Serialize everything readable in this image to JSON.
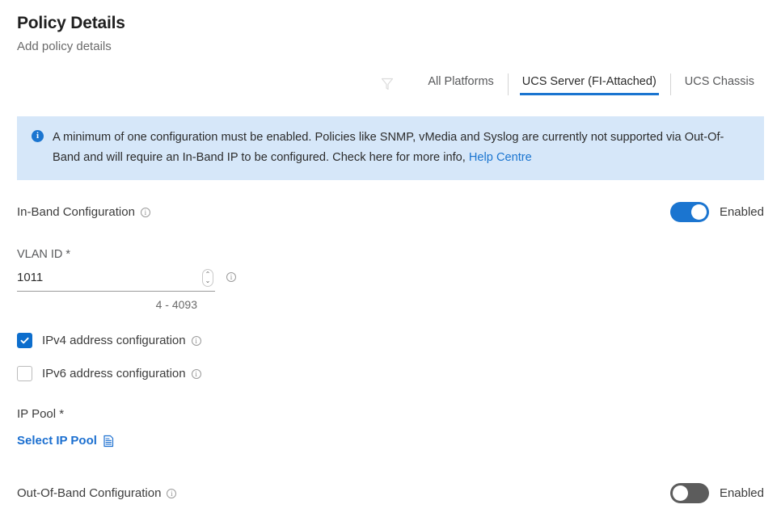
{
  "header": {
    "title": "Policy Details",
    "subtitle": "Add policy details"
  },
  "platform_tabs": {
    "filter_icon": "filter-icon",
    "items": [
      {
        "label": "All Platforms",
        "active": false
      },
      {
        "label": "UCS Server (FI-Attached)",
        "active": true
      },
      {
        "label": "UCS Chassis",
        "active": false
      }
    ]
  },
  "banner": {
    "icon": "info-circle-icon",
    "text": "A minimum of one configuration must be enabled. Policies like SNMP, vMedia and Syslog are currently not supported via Out-Of-Band and will require an In-Band IP to be configured. Check here for more info, ",
    "link_label": "Help Centre",
    "background": "#d6e7f9",
    "accent": "#1b75d0"
  },
  "in_band": {
    "label": "In-Band Configuration",
    "info_icon": "info-icon",
    "toggle_state": "on",
    "toggle_label": "Enabled",
    "toggle_color": "#1b75d0"
  },
  "vlan": {
    "label": "VLAN ID *",
    "value": "1011",
    "placeholder": "VLAN ID",
    "spinner_up": "⌃",
    "spinner_down": "⌄",
    "info_icon": "info-icon",
    "hint": "4 - 4093"
  },
  "checkboxes": [
    {
      "label": "IPv4 address configuration",
      "checked": true,
      "info_icon": "info-icon"
    },
    {
      "label": "IPv6 address configuration",
      "checked": false,
      "info_icon": "info-icon"
    }
  ],
  "ip_pool": {
    "label": "IP Pool *",
    "link_label": "Select IP Pool",
    "link_icon": "document-list-icon",
    "link_color": "#1b6fd0"
  },
  "out_of_band": {
    "label": "Out-Of-Band Configuration",
    "info_icon": "info-icon",
    "toggle_state": "off",
    "toggle_label": "Enabled",
    "toggle_color": "#5c5c5c"
  }
}
